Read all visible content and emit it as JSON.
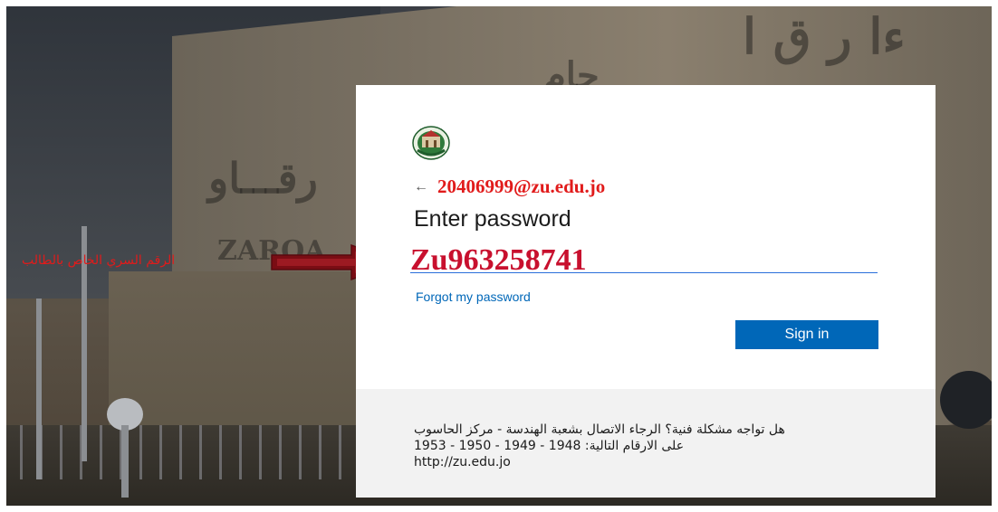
{
  "annotation": {
    "label": "الرقم السري الخاص بالطالب"
  },
  "card": {
    "identity_email": "20406999@zu.edu.jo",
    "back_glyph": "←",
    "title": "Enter password",
    "password_value": "Zu963258741",
    "forgot_link": "Forgot my password",
    "signin_label": "Sign in"
  },
  "footer": {
    "line1": "هل تواجه مشكلة فنية؟ الرجاء الاتصال بشعبة الهندسة - مركز الحاسوب",
    "line2": "على الارقام التالية: 1948 - 1949 - 1950 - 1953",
    "line3": "http://zu.edu.jo"
  },
  "colors": {
    "accent": "#0067b8",
    "annotation_red": "#e11b1b",
    "password_red": "#c8102e"
  },
  "icons": {
    "logo": "university-logo",
    "back": "back-arrow-icon",
    "annotation_arrow": "right-arrow-icon"
  }
}
